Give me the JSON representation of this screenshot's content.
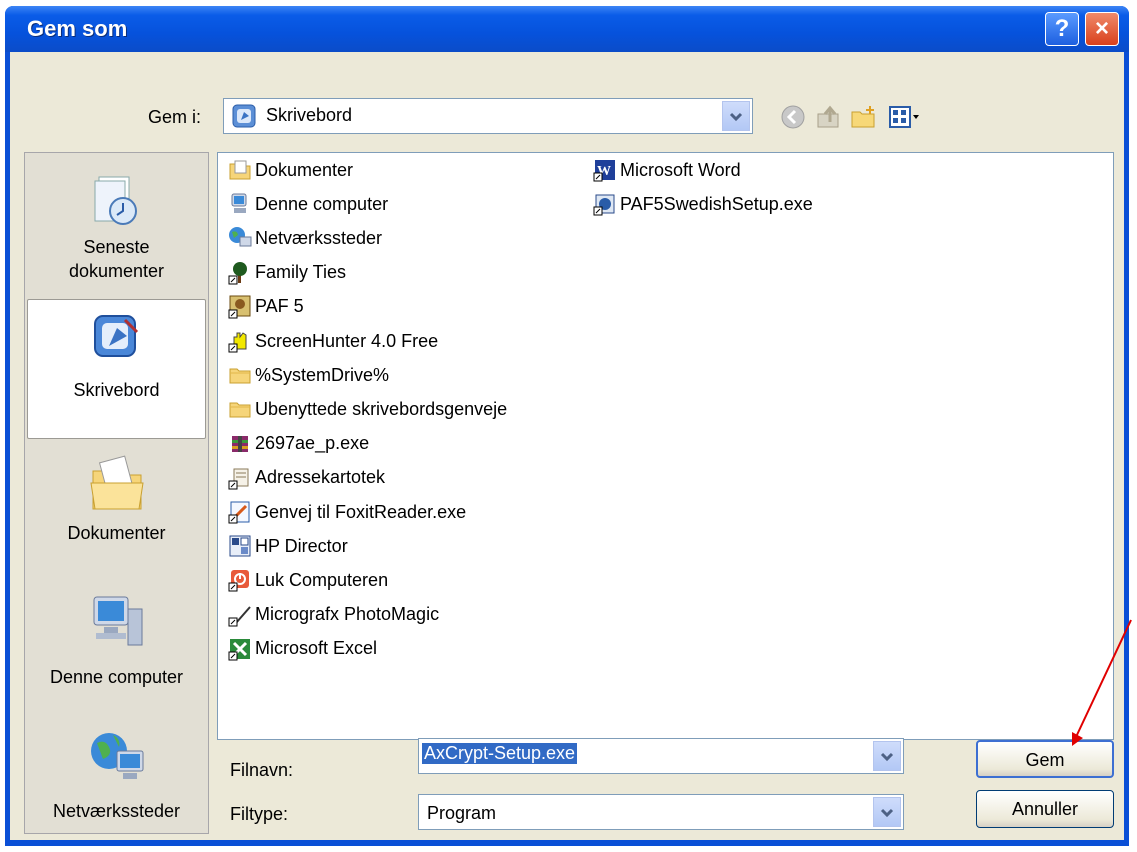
{
  "window": {
    "title": "Gem som"
  },
  "title_buttons": {
    "help": "?",
    "close": "×"
  },
  "save_in": {
    "label": "Gem i:",
    "value": "Skrivebord"
  },
  "places": [
    {
      "label_line1": "Seneste",
      "label_line2": "dokumenter",
      "icon": "recent-docs-icon"
    },
    {
      "label_line1": "Skrivebord",
      "label_line2": "",
      "icon": "desktop-icon"
    },
    {
      "label_line1": "Dokumenter",
      "label_line2": "",
      "icon": "my-documents-icon"
    },
    {
      "label_line1": "Denne computer",
      "label_line2": "",
      "icon": "my-computer-icon"
    },
    {
      "label_line1": "Netværkssteder",
      "label_line2": "",
      "icon": "network-places-icon"
    }
  ],
  "files_col1": [
    {
      "name": "Dokumenter",
      "icon": "folder-docs-icon"
    },
    {
      "name": "Denne computer",
      "icon": "computer-icon"
    },
    {
      "name": "Netværkssteder",
      "icon": "network-icon"
    },
    {
      "name": "Family Ties",
      "icon": "tree-shortcut-icon"
    },
    {
      "name": "PAF 5",
      "icon": "paf-shortcut-icon"
    },
    {
      "name": "ScreenHunter 4.0 Free",
      "icon": "hand-shortcut-icon"
    },
    {
      "name": "%SystemDrive%",
      "icon": "folder-icon"
    },
    {
      "name": "Ubenyttede skrivebordsgenveje",
      "icon": "folder-icon"
    },
    {
      "name": "2697ae_p.exe",
      "icon": "archive-exe-icon"
    },
    {
      "name": "Adressekartotek",
      "icon": "address-book-icon"
    },
    {
      "name": "Genvej til FoxitReader.exe",
      "icon": "foxit-shortcut-icon"
    },
    {
      "name": "HP Director",
      "icon": "hp-director-icon"
    },
    {
      "name": "Luk Computeren",
      "icon": "power-shortcut-icon"
    },
    {
      "name": "Micrografx PhotoMagic",
      "icon": "photomagic-shortcut-icon"
    },
    {
      "name": "Microsoft Excel",
      "icon": "excel-shortcut-icon"
    }
  ],
  "files_col2": [
    {
      "name": "Microsoft Word",
      "icon": "word-shortcut-icon"
    },
    {
      "name": "PAF5SwedishSetup.exe",
      "icon": "setup-exe-icon"
    }
  ],
  "filename": {
    "label": "Filnavn:",
    "value": "AxCrypt-Setup.exe"
  },
  "filetype": {
    "label": "Filtype:",
    "value": "Program"
  },
  "buttons": {
    "save": "Gem",
    "cancel": "Annuller"
  },
  "colors": {
    "title_bar": "#0a5ce8",
    "dialog_bg": "#ece9d8",
    "selection": "#316ac5",
    "annotation_arrow": "#e00000"
  }
}
